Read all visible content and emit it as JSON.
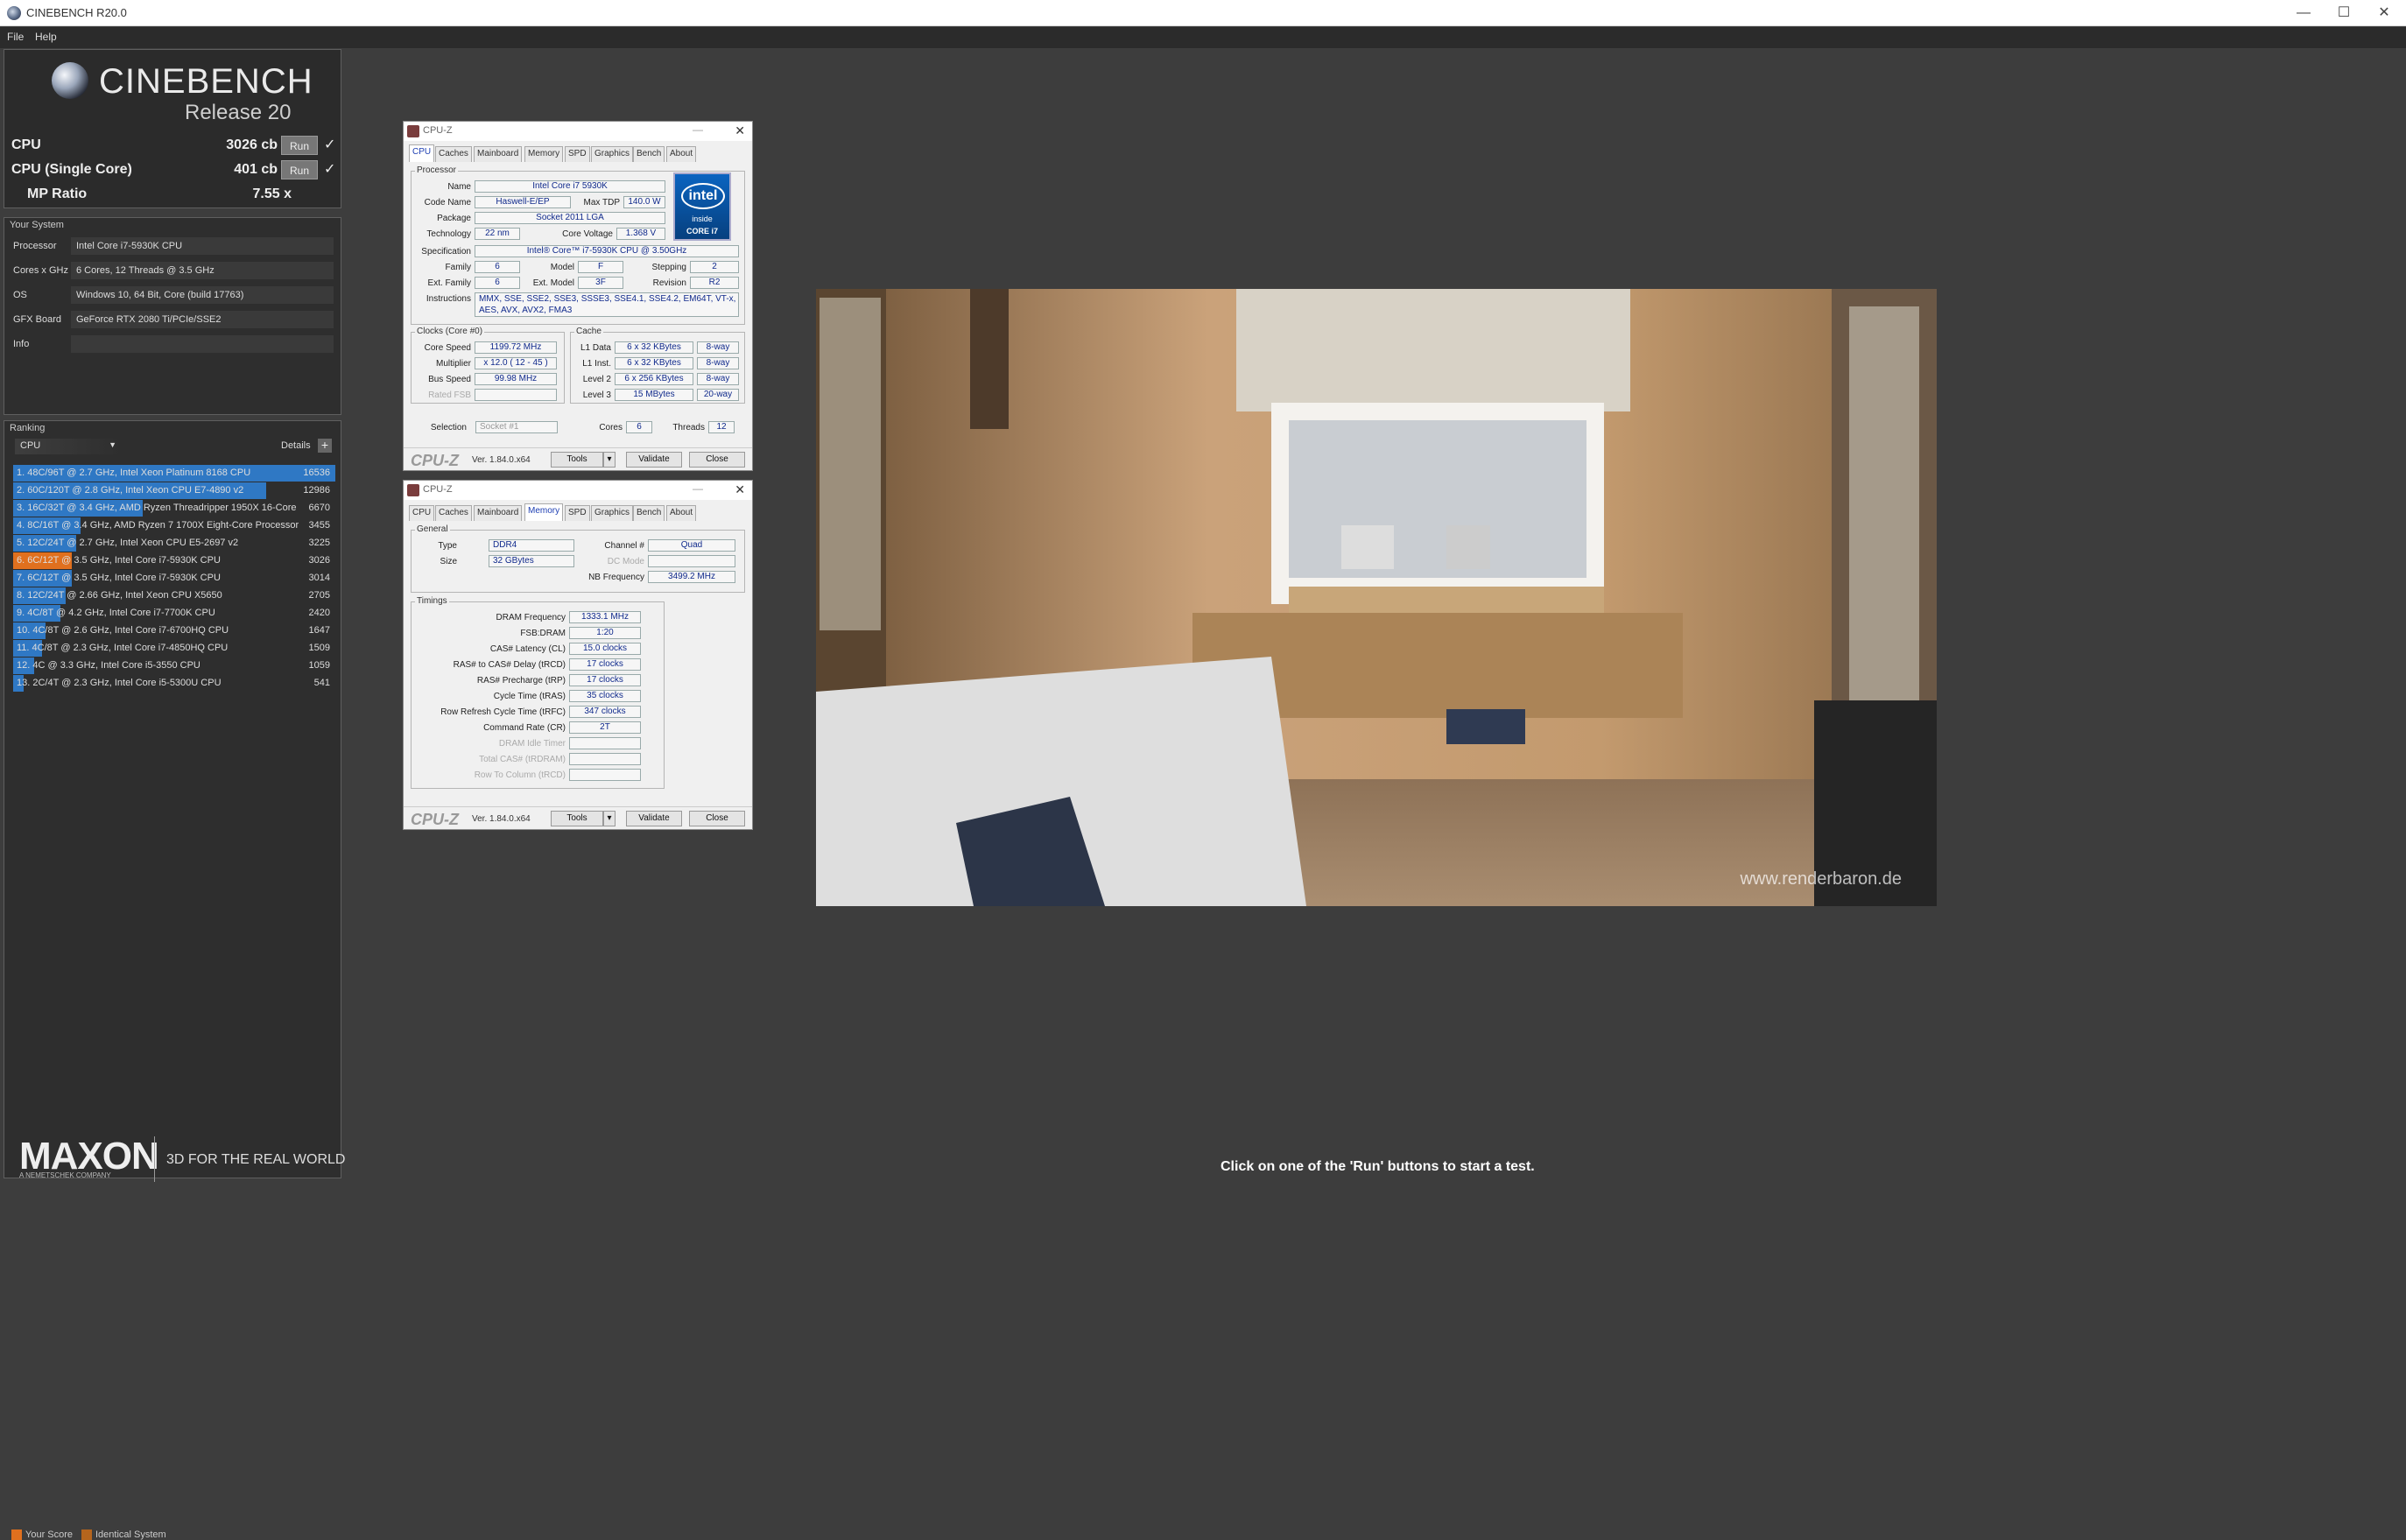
{
  "window": {
    "title": "CINEBENCH R20.0",
    "controls": [
      "—",
      "☐",
      "✕"
    ]
  },
  "menu": [
    "File",
    "Help"
  ],
  "brand": {
    "name": "CINEBENCH",
    "release": "Release 20"
  },
  "scores": {
    "cpu": {
      "label": "CPU",
      "value": "3026 cb",
      "run": "Run",
      "check": "✓"
    },
    "single": {
      "label": "CPU (Single Core)",
      "value": "401 cb",
      "run": "Run",
      "check": "✓"
    },
    "mp": {
      "label": "MP Ratio",
      "value": "7.55 x"
    }
  },
  "system": {
    "heading": "Your System",
    "rows": [
      {
        "label": "Processor",
        "value": "Intel Core i7-5930K CPU"
      },
      {
        "label": "Cores x GHz",
        "value": "6 Cores, 12 Threads @ 3.5 GHz"
      },
      {
        "label": "OS",
        "value": "Windows 10, 64 Bit, Core (build 17763)"
      },
      {
        "label": "GFX Board",
        "value": "GeForce RTX 2080 Ti/PCIe/SSE2"
      },
      {
        "label": "Info",
        "value": ""
      }
    ]
  },
  "ranking": {
    "heading": "Ranking",
    "selector": "CPU",
    "details": "Details",
    "rows": [
      {
        "text": "1. 48C/96T @ 2.7 GHz, Intel Xeon Platinum 8168 CPU",
        "score": "16536",
        "bar": 1.0,
        "color": "#2f78c4"
      },
      {
        "text": "2. 60C/120T @ 2.8 GHz, Intel Xeon CPU E7-4890 v2",
        "score": "12986",
        "bar": 0.785,
        "color": "#2f78c4"
      },
      {
        "text": "3. 16C/32T @ 3.4 GHz, AMD Ryzen Threadripper 1950X 16-Core",
        "score": "6670",
        "bar": 0.403,
        "color": "#2f78c4"
      },
      {
        "text": "4. 8C/16T @ 3.4 GHz, AMD Ryzen 7 1700X Eight-Core Processor",
        "score": "3455",
        "bar": 0.209,
        "color": "#2f78c4"
      },
      {
        "text": "5. 12C/24T @ 2.7 GHz, Intel Xeon CPU E5-2697 v2",
        "score": "3225",
        "bar": 0.195,
        "color": "#2f78c4"
      },
      {
        "text": "6. 6C/12T @ 3.5 GHz, Intel Core i7-5930K CPU",
        "score": "3026",
        "bar": 0.183,
        "color": "#e0701e"
      },
      {
        "text": "7. 6C/12T @ 3.5 GHz, Intel Core i7-5930K CPU",
        "score": "3014",
        "bar": 0.182,
        "color": "#2f78c4"
      },
      {
        "text": "8. 12C/24T @ 2.66 GHz, Intel Xeon CPU X5650",
        "score": "2705",
        "bar": 0.164,
        "color": "#2f78c4"
      },
      {
        "text": "9. 4C/8T @ 4.2 GHz, Intel Core i7-7700K CPU",
        "score": "2420",
        "bar": 0.146,
        "color": "#2f78c4"
      },
      {
        "text": "10. 4C/8T @ 2.6 GHz, Intel Core i7-6700HQ CPU",
        "score": "1647",
        "bar": 0.1,
        "color": "#2f78c4"
      },
      {
        "text": "11. 4C/8T @ 2.3 GHz, Intel Core i7-4850HQ CPU",
        "score": "1509",
        "bar": 0.091,
        "color": "#2f78c4"
      },
      {
        "text": "12. 4C @ 3.3 GHz, Intel Core i5-3550 CPU",
        "score": "1059",
        "bar": 0.064,
        "color": "#2f78c4"
      },
      {
        "text": "13. 2C/4T @ 2.3 GHz, Intel Core i5-5300U CPU",
        "score": "541",
        "bar": 0.033,
        "color": "#2f78c4"
      }
    ],
    "legend": {
      "your_score": "Your Score",
      "identical": "Identical System",
      "your_color": "#e0701e",
      "identical_color": "#b5651d"
    }
  },
  "footer": {
    "logo": "MAXON",
    "sub": "A NEMETSCHEK COMPANY",
    "tagline": "3D FOR THE REAL WORLD",
    "status": "Click on one of the 'Run' buttons to start a test."
  },
  "cpuz1": {
    "title": "CPU-Z",
    "tabs": [
      "CPU",
      "Caches",
      "Mainboard",
      "Memory",
      "SPD",
      "Graphics",
      "Bench",
      "About"
    ],
    "active_tab": "CPU",
    "processor": {
      "group": "Processor",
      "name_l": "Name",
      "name": "Intel Core i7 5930K",
      "code_l": "Code Name",
      "code": "Haswell-E/EP",
      "tdp_l": "Max TDP",
      "tdp": "140.0 W",
      "pkg_l": "Package",
      "pkg": "Socket 2011 LGA",
      "tech_l": "Technology",
      "tech": "22 nm",
      "volt_l": "Core Voltage",
      "volt": "1.368 V",
      "spec_l": "Specification",
      "spec": "Intel® Core™ i7-5930K CPU @ 3.50GHz",
      "fam_l": "Family",
      "fam": "6",
      "mod_l": "Model",
      "mod": "F",
      "step_l": "Stepping",
      "step": "2",
      "efam_l": "Ext. Family",
      "efam": "6",
      "emod_l": "Ext. Model",
      "emod": "3F",
      "rev_l": "Revision",
      "rev": "R2",
      "ins_l": "Instructions",
      "ins1": "MMX, SSE, SSE2, SSE3, SSSE3, SSE4.1, SSE4.2, EM64T, VT-x,",
      "ins2": "AES, AVX, AVX2, FMA3"
    },
    "intel": {
      "brand": "intel",
      "inside": "inside",
      "core": "CORE i7"
    },
    "clocks": {
      "group": "Clocks (Core #0)",
      "cs_l": "Core Speed",
      "cs": "1199.72 MHz",
      "mul_l": "Multiplier",
      "mul": "x 12.0 ( 12 - 45 )",
      "bus_l": "Bus Speed",
      "bus": "99.98 MHz",
      "fsb_l": "Rated FSB",
      "fsb": ""
    },
    "cache": {
      "group": "Cache",
      "l1d_l": "L1 Data",
      "l1d": "6 x 32 KBytes",
      "l1d_w": "8-way",
      "l1i_l": "L1 Inst.",
      "l1i": "6 x 32 KBytes",
      "l1i_w": "8-way",
      "l2_l": "Level 2",
      "l2": "6 x 256 KBytes",
      "l2_w": "8-way",
      "l3_l": "Level 3",
      "l3": "15 MBytes",
      "l3_w": "20-way"
    },
    "sel_l": "Selection",
    "sel": "Socket #1",
    "cores_l": "Cores",
    "cores": "6",
    "threads_l": "Threads",
    "threads": "12",
    "logo": "CPU-Z",
    "ver": "Ver. 1.84.0.x64",
    "tools": "Tools",
    "validate": "Validate",
    "close": "Close"
  },
  "cpuz2": {
    "title": "CPU-Z",
    "tabs": [
      "CPU",
      "Caches",
      "Mainboard",
      "Memory",
      "SPD",
      "Graphics",
      "Bench",
      "About"
    ],
    "active_tab": "Memory",
    "general": {
      "group": "General",
      "type_l": "Type",
      "type": "DDR4",
      "ch_l": "Channel #",
      "ch": "Quad",
      "dc_l": "DC Mode",
      "dc": "",
      "size_l": "Size",
      "size": "32 GBytes",
      "nb_l": "NB Frequency",
      "nb": "3499.2 MHz"
    },
    "timings": {
      "group": "Timings",
      "rows": [
        {
          "label": "DRAM Frequency",
          "value": "1333.1 MHz",
          "dim": false
        },
        {
          "label": "FSB:DRAM",
          "value": "1:20",
          "dim": false
        },
        {
          "label": "CAS# Latency (CL)",
          "value": "15.0 clocks",
          "dim": false
        },
        {
          "label": "RAS# to CAS# Delay (tRCD)",
          "value": "17 clocks",
          "dim": false
        },
        {
          "label": "RAS# Precharge (tRP)",
          "value": "17 clocks",
          "dim": false
        },
        {
          "label": "Cycle Time (tRAS)",
          "value": "35 clocks",
          "dim": false
        },
        {
          "label": "Row Refresh Cycle Time (tRFC)",
          "value": "347 clocks",
          "dim": false
        },
        {
          "label": "Command Rate (CR)",
          "value": "2T",
          "dim": false
        },
        {
          "label": "DRAM Idle Timer",
          "value": "",
          "dim": true
        },
        {
          "label": "Total CAS# (tRDRAM)",
          "value": "",
          "dim": true
        },
        {
          "label": "Row To Column (tRCD)",
          "value": "",
          "dim": true
        }
      ]
    },
    "logo": "CPU-Z",
    "ver": "Ver. 1.84.0.x64",
    "tools": "Tools",
    "validate": "Validate",
    "close": "Close"
  },
  "render": {
    "watermark": "www.renderbaron.de"
  }
}
